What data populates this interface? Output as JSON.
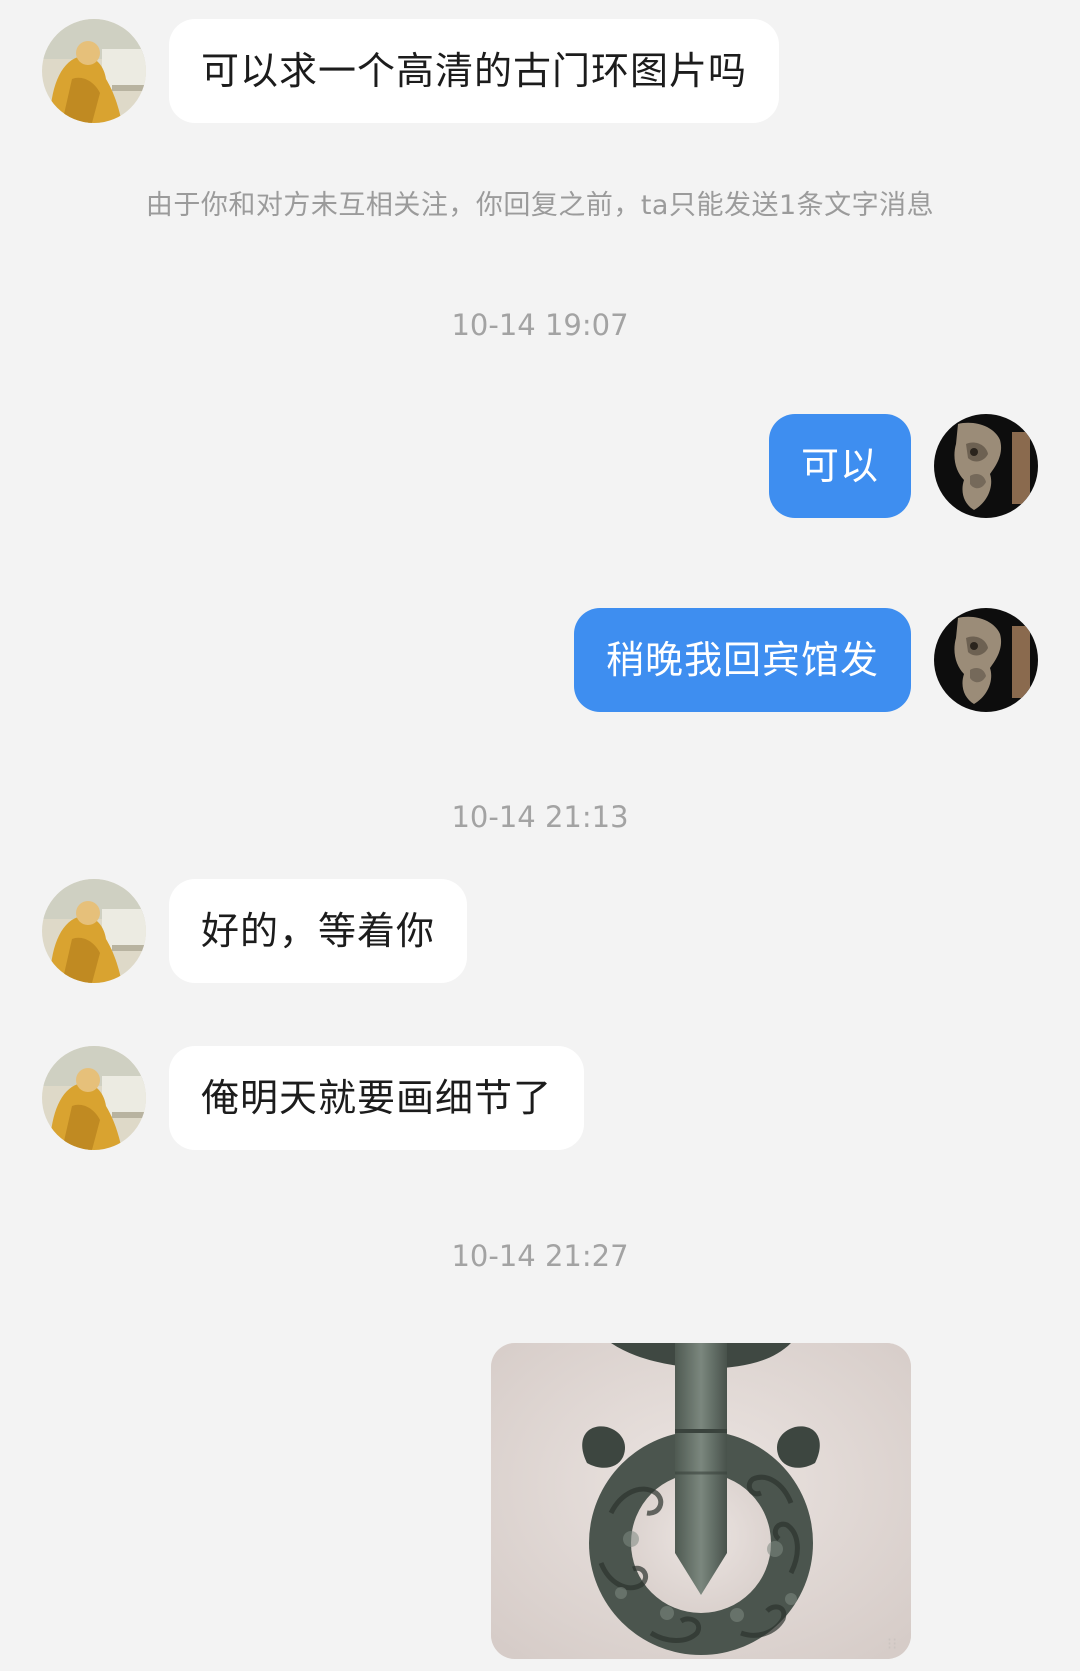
{
  "conversation": {
    "msg1": "可以求一个高清的古门环图片吗",
    "notice": "由于你和对方未互相关注，你回复之前，ta只能发送1条文字消息",
    "time1": "10-14 19:07",
    "reply1": "可以",
    "reply2": "稍晚我回宾馆发",
    "time2": "10-14 21:13",
    "msg2": "好的，等着你",
    "msg3": "俺明天就要画细节了",
    "time3": "10-14 21:27"
  },
  "colors": {
    "background": "#f3f3f3",
    "incoming_bubble": "#ffffff",
    "outgoing_bubble": "#3e8ef0",
    "meta_text": "#9b9b9b"
  },
  "icons": {
    "other_avatar": "person-in-yellow-robe-avatar",
    "self_avatar": "carved-wooden-bracket-avatar",
    "sent_image": "ancient-door-ring-photo"
  }
}
